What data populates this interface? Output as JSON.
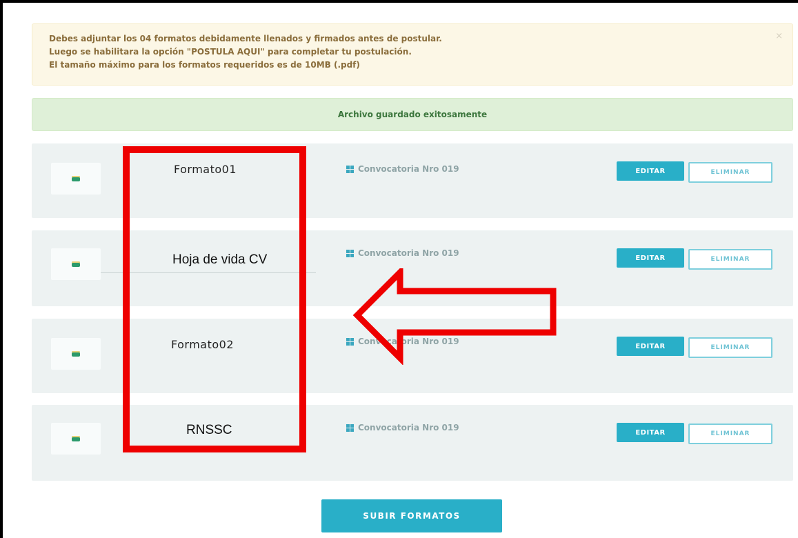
{
  "alerts": {
    "warning_lines": [
      "Debes adjuntar los 04 formatos debidamente llenados y firmados antes de postular.",
      "Luego se habilitara la opción \"POSTULA AQUI\" para completar tu postulación.",
      "El tamaño máximo para los formatos requeridos es de 10MB (.pdf)"
    ],
    "close_glyph": "×",
    "success": "Archivo guardado exitosamente"
  },
  "documents": [
    {
      "title": "Formato01",
      "convocatoria": "Convocatoria Nro 019",
      "edit_label": "EDITAR",
      "delete_label": "ELIMINAR"
    },
    {
      "title": "Hoja de vida CV",
      "convocatoria": "Convocatoria Nro 019",
      "edit_label": "EDITAR",
      "delete_label": "ELIMINAR"
    },
    {
      "title": "Formato02",
      "convocatoria": "Convocatoria Nro 019",
      "edit_label": "EDITAR",
      "delete_label": "ELIMINAR"
    },
    {
      "title": "RNSSC",
      "convocatoria": "Convocatoria Nro 019",
      "edit_label": "EDITAR",
      "delete_label": "ELIMINAR"
    }
  ],
  "submit_label": "SUBIR FORMATOS",
  "colors": {
    "accent": "#29afc8",
    "annotation": "#ee0000",
    "warning_bg": "#fcf7e6",
    "success_bg": "#dff0d8"
  }
}
